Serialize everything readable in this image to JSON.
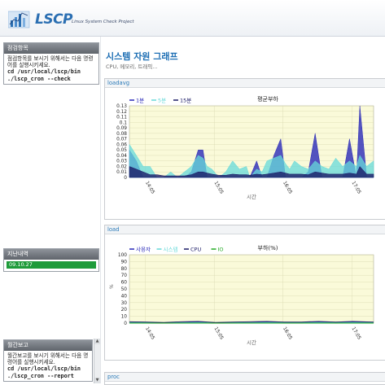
{
  "header": {
    "logo_text": "LSCP",
    "logo_subtitle": "Linux System Check Project"
  },
  "sidebar": {
    "check_items": {
      "title": "점검항목",
      "desc": "점검항목를 보시기 위해서는 다음 명령어를 실행시키세요.",
      "cmd1": "cd /usr/local/lscp/bin",
      "cmd2": "./lscp_cron --check"
    },
    "history": {
      "title": "지난내역",
      "item": "09.10.27"
    },
    "monthly_report": {
      "title": "월간보고",
      "desc": "월간보고를 보시기 위해서는 다음 명령어를 실행시키세요.",
      "cmd1": "cd /usr/local/lscp/bin",
      "cmd2": "./lscp_cron --report"
    }
  },
  "main": {
    "page_title": "시스템 자원 그래프",
    "page_subtitle": "CPU, 메모리, 트래픽..."
  },
  "panels": {
    "loadavg_label": "loadavg",
    "load_label": "load",
    "proc_label": "proc"
  },
  "colors": {
    "chart_bg": "#fafad9",
    "series_1min": "#2929b8",
    "series_5min": "#66d9d9",
    "series_15min": "#1a1a66",
    "io": "#22aa22",
    "history_green": "#1e9b3a",
    "title_blue": "#1e6fb4"
  },
  "chart_data": [
    {
      "type": "area",
      "title": "평균부하",
      "xlabel": "시간",
      "ylabel": "",
      "ylim": [
        0,
        0.13
      ],
      "yticks": [
        0,
        0.01,
        0.02,
        0.03,
        0.04,
        0.05,
        0.06,
        0.07,
        0.08,
        0.09,
        0.1,
        0.11,
        0.12,
        0.13
      ],
      "x_ticks": [
        "14:05",
        "15:05",
        "16:05",
        "17:05"
      ],
      "x_range": [
        13.85,
        17.4
      ],
      "grid": true,
      "legend": "top-left",
      "series": [
        {
          "name": "1분",
          "color": "#2929b8",
          "x": [
            13.85,
            13.95,
            14.05,
            14.15,
            14.25,
            14.35,
            14.45,
            14.55,
            14.65,
            14.75,
            14.85,
            14.92,
            14.98,
            15.05,
            15.15,
            15.25,
            15.35,
            15.45,
            15.55,
            15.6,
            15.7,
            15.78,
            15.85,
            15.95,
            16.05,
            16.12,
            16.18,
            16.25,
            16.35,
            16.45,
            16.55,
            16.65,
            16.75,
            16.85,
            16.95,
            17.05,
            17.15,
            17.2,
            17.3,
            17.4
          ],
          "values": [
            0.05,
            0.03,
            0.0,
            0.0,
            0.0,
            0.0,
            0.0,
            0.0,
            0.0,
            0.01,
            0.05,
            0.05,
            0.0,
            0.0,
            0.0,
            0.0,
            0.0,
            0.0,
            0.0,
            0.0,
            0.03,
            0.0,
            0.0,
            0.04,
            0.07,
            0.0,
            0.0,
            0.0,
            0.0,
            0.01,
            0.08,
            0.0,
            0.0,
            0.0,
            0.0,
            0.07,
            0.0,
            0.13,
            0.0,
            0.0
          ]
        },
        {
          "name": "5분",
          "color": "#66d9d9",
          "x": [
            13.85,
            13.95,
            14.05,
            14.15,
            14.25,
            14.35,
            14.45,
            14.55,
            14.65,
            14.75,
            14.85,
            14.92,
            14.98,
            15.05,
            15.15,
            15.25,
            15.35,
            15.45,
            15.55,
            15.6,
            15.7,
            15.78,
            15.85,
            15.95,
            16.05,
            16.12,
            16.18,
            16.25,
            16.35,
            16.45,
            16.55,
            16.65,
            16.75,
            16.85,
            16.95,
            17.05,
            17.15,
            17.2,
            17.3,
            17.4
          ],
          "values": [
            0.06,
            0.04,
            0.02,
            0.02,
            0.0,
            0.0,
            0.01,
            0.0,
            0.01,
            0.02,
            0.04,
            0.035,
            0.02,
            0.015,
            0.0,
            0.01,
            0.03,
            0.015,
            0.02,
            0.0,
            0.015,
            0.01,
            0.03,
            0.035,
            0.04,
            0.025,
            0.015,
            0.03,
            0.02,
            0.015,
            0.03,
            0.02,
            0.015,
            0.035,
            0.02,
            0.03,
            0.02,
            0.04,
            0.02,
            0.03
          ]
        },
        {
          "name": "15분",
          "color": "#1a1a66",
          "x": [
            13.85,
            13.95,
            14.05,
            14.15,
            14.25,
            14.35,
            14.45,
            14.55,
            14.65,
            14.75,
            14.85,
            14.92,
            14.98,
            15.05,
            15.15,
            15.25,
            15.35,
            15.45,
            15.55,
            15.6,
            15.7,
            15.78,
            15.85,
            15.95,
            16.05,
            16.12,
            16.18,
            16.25,
            16.35,
            16.45,
            16.55,
            16.65,
            16.75,
            16.85,
            16.95,
            17.05,
            17.15,
            17.2,
            17.3,
            17.4
          ],
          "values": [
            0.02,
            0.015,
            0.01,
            0.005,
            0.005,
            0.003,
            0.003,
            0.003,
            0.003,
            0.005,
            0.01,
            0.01,
            0.008,
            0.006,
            0.004,
            0.004,
            0.006,
            0.005,
            0.005,
            0.004,
            0.006,
            0.005,
            0.006,
            0.008,
            0.01,
            0.008,
            0.006,
            0.006,
            0.006,
            0.005,
            0.01,
            0.008,
            0.006,
            0.006,
            0.006,
            0.008,
            0.006,
            0.02,
            0.006,
            0.006
          ]
        }
      ]
    },
    {
      "type": "line",
      "title": "부하(%)",
      "xlabel": "시간",
      "ylabel": "%",
      "ylim": [
        0,
        100
      ],
      "yticks": [
        0,
        10,
        20,
        30,
        40,
        50,
        60,
        70,
        80,
        90,
        100
      ],
      "x_ticks": [
        "14:05",
        "15:05",
        "16:05",
        "17:05"
      ],
      "x_range": [
        13.85,
        17.4
      ],
      "grid": true,
      "legend": "top-left",
      "series": [
        {
          "name": "사용자",
          "color": "#2929b8",
          "x": [
            13.85,
            14.1,
            14.35,
            14.6,
            14.85,
            15.1,
            15.35,
            15.6,
            15.85,
            16.1,
            16.35,
            16.6,
            16.85,
            17.1,
            17.4
          ],
          "values": [
            1,
            1,
            0.5,
            1,
            1.5,
            0.5,
            1,
            1,
            1.5,
            1,
            1,
            1.5,
            1,
            1.5,
            1
          ]
        },
        {
          "name": "시스템",
          "color": "#66d9d9",
          "x": [
            13.85,
            14.1,
            14.35,
            14.6,
            14.85,
            15.1,
            15.35,
            15.6,
            15.85,
            16.1,
            16.35,
            16.6,
            16.85,
            17.1,
            17.4
          ],
          "values": [
            0.5,
            0.5,
            0.3,
            0.5,
            0.8,
            0.3,
            0.5,
            0.5,
            0.8,
            0.5,
            0.5,
            0.8,
            0.5,
            0.8,
            0.5
          ]
        },
        {
          "name": "CPU",
          "color": "#1a1a66",
          "x": [
            13.85,
            14.1,
            14.35,
            14.6,
            14.85,
            15.1,
            15.35,
            15.6,
            15.85,
            16.1,
            16.35,
            16.6,
            16.85,
            17.1,
            17.4
          ],
          "values": [
            2,
            1.5,
            1,
            2,
            2.5,
            1,
            1.5,
            2,
            2.5,
            1.5,
            1.5,
            2.5,
            1.5,
            2.5,
            1.5
          ]
        },
        {
          "name": "IO",
          "color": "#22aa22",
          "x": [
            13.85,
            14.1,
            14.35,
            14.6,
            14.85,
            15.1,
            15.35,
            15.6,
            15.85,
            16.1,
            16.35,
            16.6,
            16.85,
            17.1,
            17.4
          ],
          "values": [
            0,
            0,
            0,
            0,
            0,
            0,
            0,
            0,
            0,
            0,
            0,
            0,
            0,
            0,
            0
          ]
        }
      ]
    }
  ]
}
